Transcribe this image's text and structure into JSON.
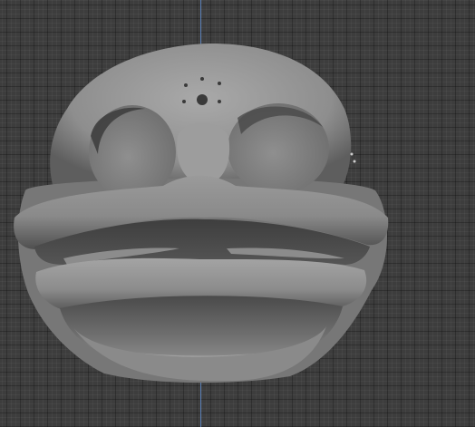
{
  "viewport": {
    "grid_color": "#3d3d3d",
    "z_axis_color": "#5e88c8"
  },
  "model": {
    "material_color": "#9a9a9a"
  }
}
